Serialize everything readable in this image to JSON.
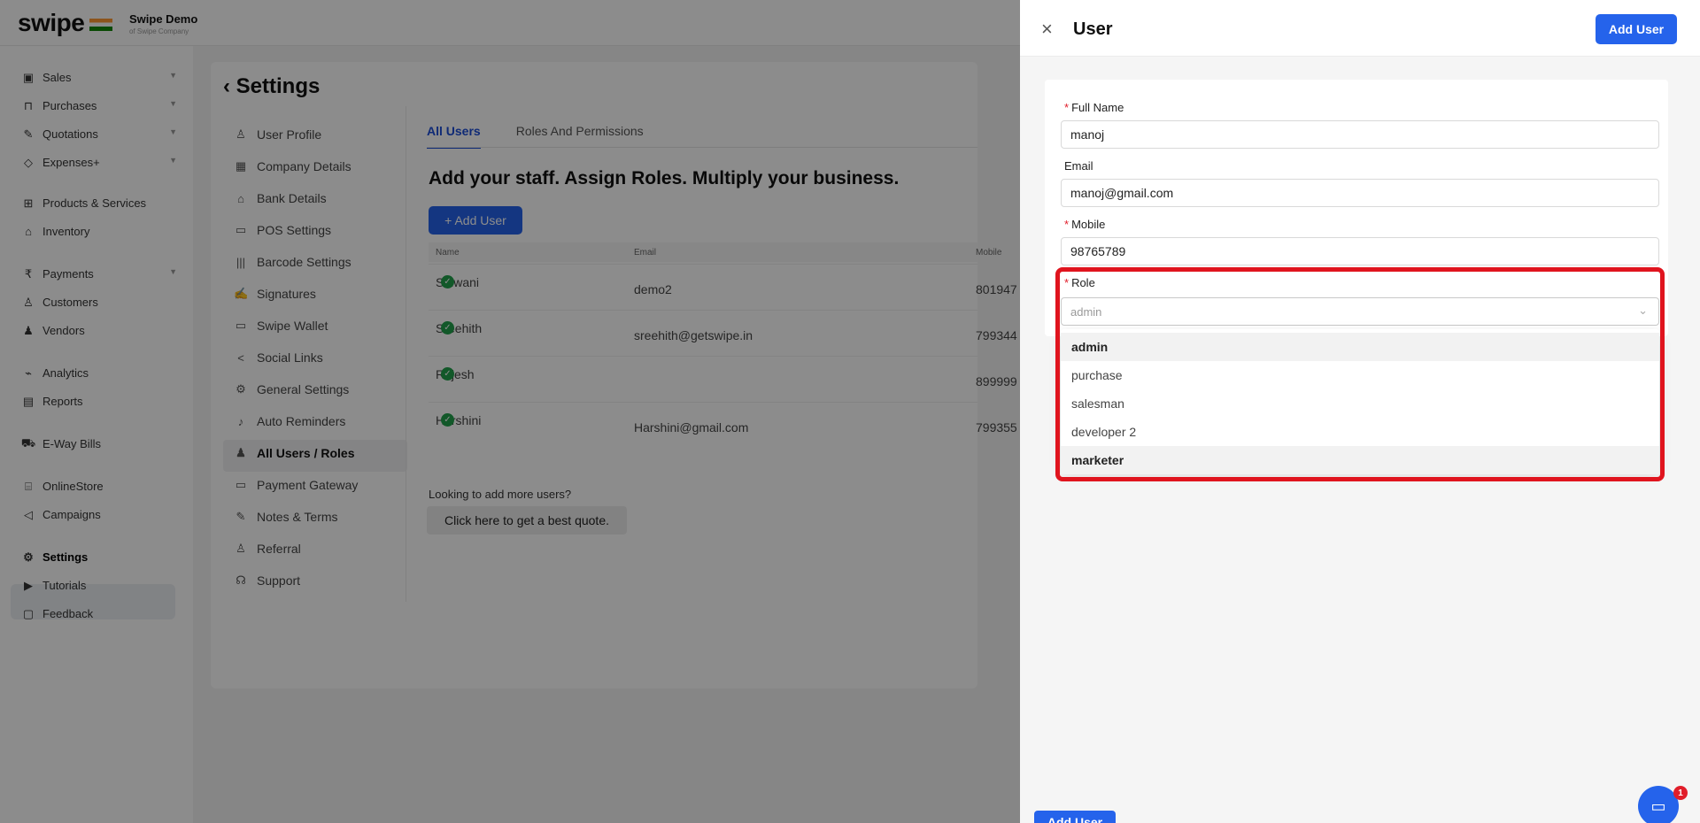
{
  "header": {
    "logo": "swipe",
    "company_name": "Swipe Demo",
    "company_sub": "of Swipe Company"
  },
  "sidebar": {
    "items": [
      {
        "label": "Sales",
        "icon": "sales-icon",
        "chevron": true
      },
      {
        "label": "Purchases",
        "icon": "cart-icon",
        "chevron": true
      },
      {
        "label": "Quotations",
        "icon": "pen-icon",
        "chevron": true
      },
      {
        "label": "Expenses+",
        "icon": "tag-icon",
        "chevron": true
      },
      {
        "label": "Products & Services",
        "icon": "box-icon",
        "chevron": false
      },
      {
        "label": "Inventory",
        "icon": "warehouse-icon",
        "chevron": false
      },
      {
        "label": "Payments",
        "icon": "rupee-icon",
        "chevron": true
      },
      {
        "label": "Customers",
        "icon": "user-icon",
        "chevron": false
      },
      {
        "label": "Vendors",
        "icon": "users-icon",
        "chevron": false
      },
      {
        "label": "Analytics",
        "icon": "chart-icon",
        "chevron": false
      },
      {
        "label": "Reports",
        "icon": "report-icon",
        "chevron": false
      },
      {
        "label": "E-Way Bills",
        "icon": "truck-icon",
        "chevron": false
      },
      {
        "label": "OnlineStore",
        "icon": "store-icon",
        "chevron": false
      },
      {
        "label": "Campaigns",
        "icon": "megaphone-icon",
        "chevron": false
      },
      {
        "label": "Settings",
        "icon": "gear-icon",
        "chevron": false,
        "active": true
      },
      {
        "label": "Tutorials",
        "icon": "video-icon",
        "chevron": false
      },
      {
        "label": "Feedback",
        "icon": "feedback-icon",
        "chevron": false
      }
    ]
  },
  "settings": {
    "title": "Settings",
    "nav": [
      {
        "label": "User Profile",
        "icon": "user-icon"
      },
      {
        "label": "Company Details",
        "icon": "building-icon"
      },
      {
        "label": "Bank Details",
        "icon": "bank-icon"
      },
      {
        "label": "POS Settings",
        "icon": "pos-icon"
      },
      {
        "label": "Barcode Settings",
        "icon": "barcode-icon"
      },
      {
        "label": "Signatures",
        "icon": "signature-icon"
      },
      {
        "label": "Swipe Wallet",
        "icon": "wallet-icon"
      },
      {
        "label": "Social Links",
        "icon": "share-icon"
      },
      {
        "label": "General Settings",
        "icon": "gear-icon"
      },
      {
        "label": "Auto Reminders",
        "icon": "bell-icon"
      },
      {
        "label": "All Users / Roles",
        "icon": "users-icon",
        "active": true
      },
      {
        "label": "Payment Gateway",
        "icon": "card-icon"
      },
      {
        "label": "Notes & Terms",
        "icon": "note-icon"
      },
      {
        "label": "Referral",
        "icon": "referral-icon"
      },
      {
        "label": "Support",
        "icon": "headset-icon"
      }
    ]
  },
  "users_page": {
    "tabs": [
      "All Users",
      "Roles And Permissions"
    ],
    "headline": "Add your staff. Assign Roles. Multiply your business.",
    "add_button": "+ Add User",
    "columns": [
      "Name",
      "Email",
      "Mobile"
    ],
    "rows": [
      {
        "name": "Shiwani",
        "email": "demo2",
        "mobile": "801947"
      },
      {
        "name": "Sreehith",
        "email": "sreehith@getswipe.in",
        "mobile": "799344"
      },
      {
        "name": "Rajesh",
        "email": "",
        "mobile": "899999"
      },
      {
        "name": "Harshini",
        "email": "Harshini@gmail.com",
        "mobile": "799355"
      }
    ],
    "more_users_text": "Looking to add more users?",
    "quote_button": "Click here to get a best quote."
  },
  "drawer": {
    "title": "User",
    "add_button": "Add User",
    "footer_button": "Add User",
    "fields": {
      "full_name": {
        "label": "Full Name",
        "required": true,
        "value": "manoj"
      },
      "email": {
        "label": "Email",
        "required": false,
        "value": "manoj@gmail.com"
      },
      "mobile": {
        "label": "Mobile",
        "required": true,
        "value": "98765789"
      },
      "role": {
        "label": "Role",
        "required": true,
        "placeholder": "admin"
      }
    },
    "role_options": [
      "admin",
      "purchase",
      "salesman",
      "developer 2",
      "marketer"
    ],
    "highlighted_options": [
      "admin",
      "marketer"
    ]
  },
  "chat": {
    "badge": "1"
  },
  "colors": {
    "accent": "#2563eb",
    "highlight_box": "#e0141e",
    "success": "#22a04b"
  }
}
